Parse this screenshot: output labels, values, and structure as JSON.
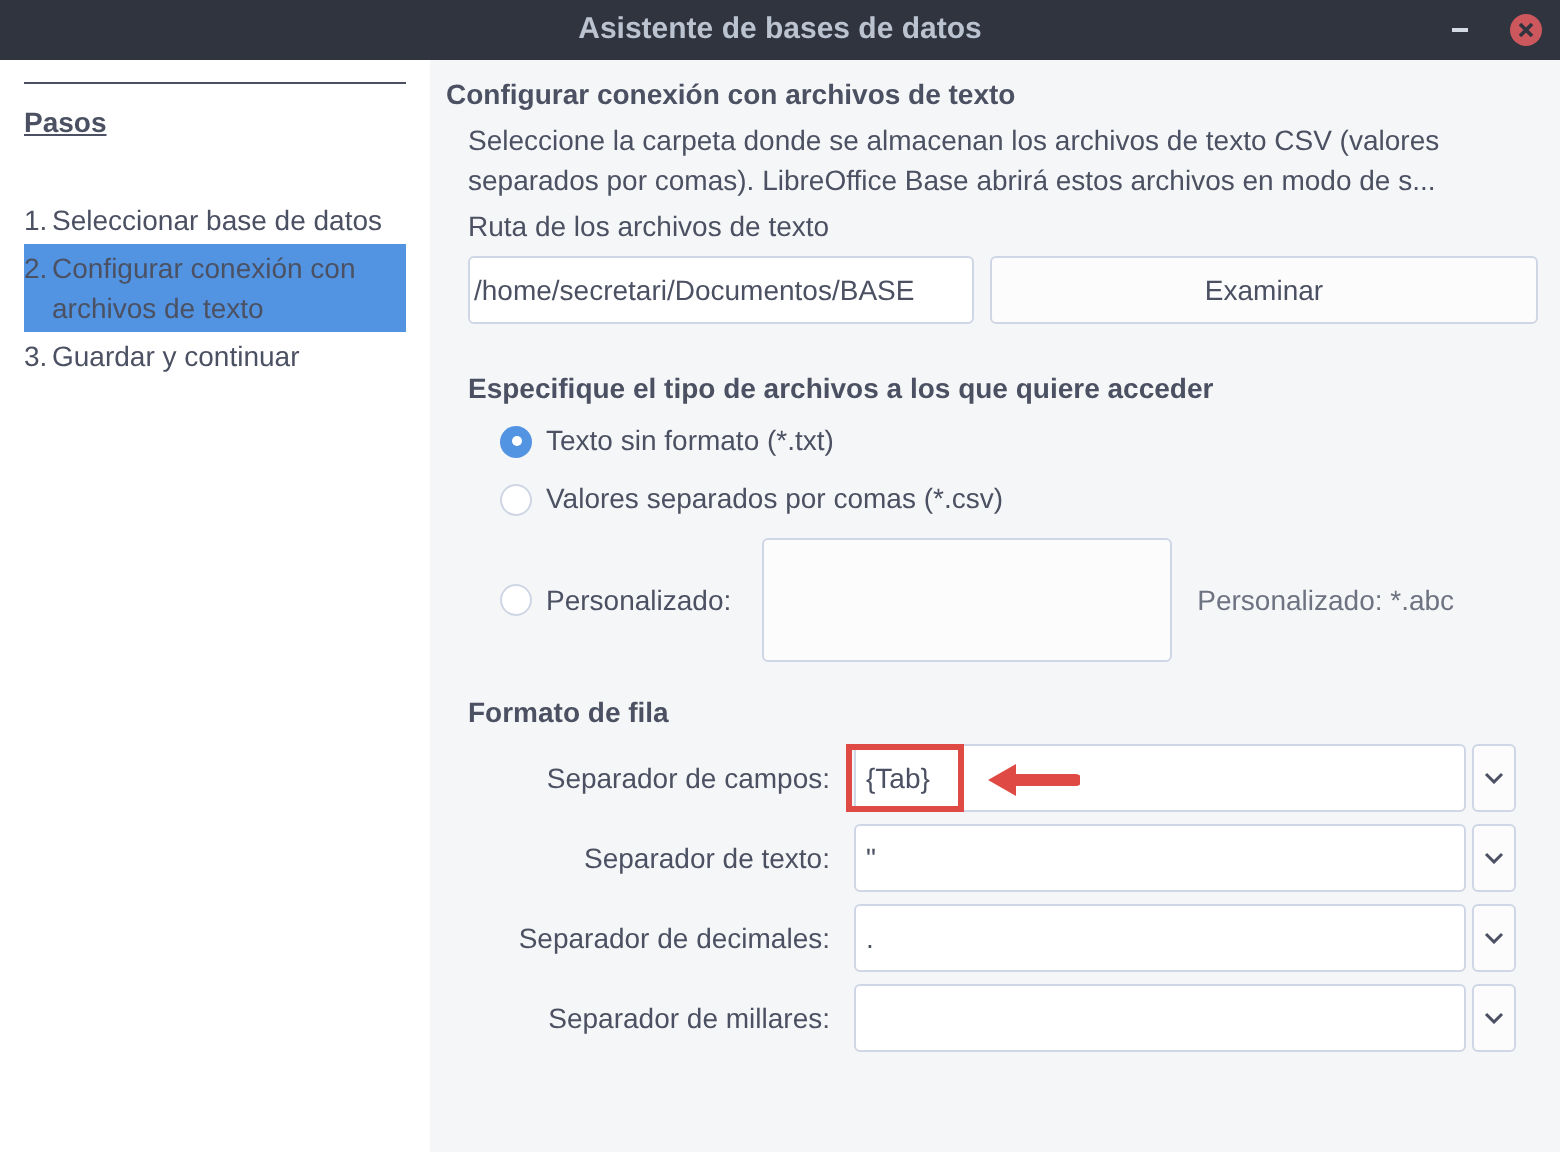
{
  "window": {
    "title": "Asistente de bases de datos"
  },
  "sidebar": {
    "heading": "Pasos",
    "items": [
      {
        "number": "1.",
        "label": "Seleccionar base de datos",
        "selected": false
      },
      {
        "number": "2.",
        "label": "Configurar conexión con archivos de texto",
        "selected": true
      },
      {
        "number": "3.",
        "label": "Guardar y continuar",
        "selected": false
      }
    ]
  },
  "main": {
    "title": "Configurar conexión con archivos de texto",
    "description": [
      "Seleccione la carpeta donde se almacenan los archivos de texto CSV (valores",
      "separados por comas). LibreOffice Base abrirá estos archivos en modo de s..."
    ],
    "path_label": "Ruta de los archivos de texto",
    "path_value": "/home/secretari/Documentos/BASE",
    "browse_button": "Examinar",
    "file_type": {
      "heading": "Especifique el tipo de archivos a los que quiere acceder",
      "options": [
        {
          "label": "Texto sin formato (*.txt)",
          "selected": true,
          "kind": "plain"
        },
        {
          "label": "Valores separados por comas (*.csv)",
          "selected": false,
          "kind": "plain"
        },
        {
          "label": "Personalizado:",
          "selected": false,
          "kind": "custom",
          "hint": "Personalizado: *.abc"
        }
      ]
    },
    "row_format": {
      "heading": "Formato de fila",
      "fields": [
        {
          "label": "Separador de campos:",
          "value": "{Tab}",
          "highlighted": true
        },
        {
          "label": "Separador de texto:",
          "value": "\"",
          "highlighted": false
        },
        {
          "label": "Separador de decimales:",
          "value": ".",
          "highlighted": false
        },
        {
          "label": "Separador de millares:",
          "highlighted": false
        }
      ]
    }
  }
}
